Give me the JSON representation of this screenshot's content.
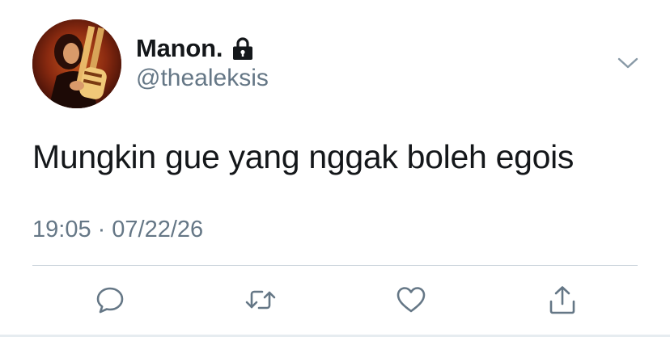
{
  "user": {
    "display_name": "Manon.",
    "handle": "@thealeksis",
    "protected": true
  },
  "tweet": {
    "text": "Mungkin gue yang nggak boleh egois",
    "time": "19:05",
    "separator": "·",
    "date": "07/22/26"
  },
  "icons": {
    "avatar": "avatar-photo",
    "lock": "lock-icon",
    "more": "chevron-down-icon",
    "reply": "reply-icon",
    "retweet": "retweet-icon",
    "like": "heart-icon",
    "share": "share-icon"
  },
  "colors": {
    "text": "#14171a",
    "secondary": "#657786",
    "divider": "#cfd7de",
    "icon": "#657786"
  }
}
